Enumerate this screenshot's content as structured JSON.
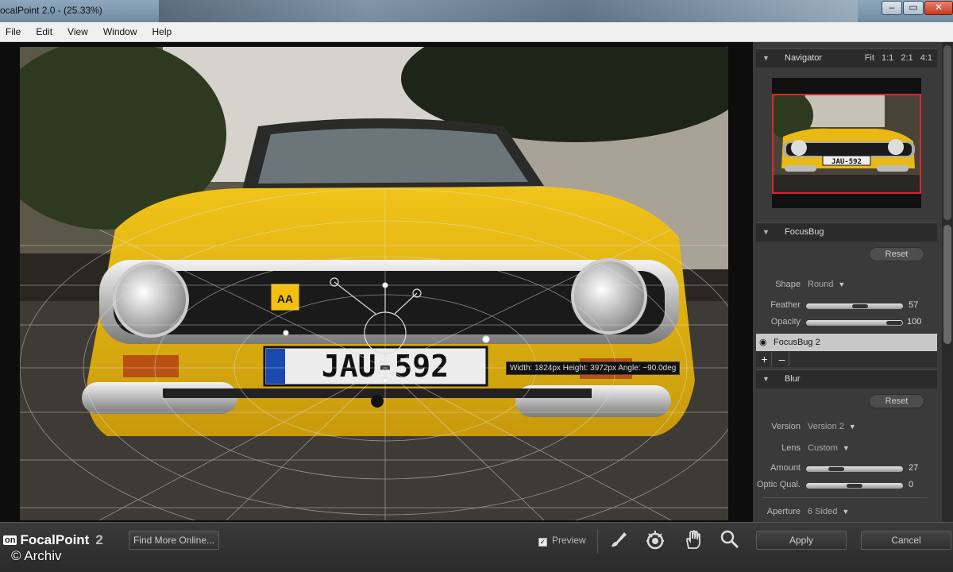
{
  "window": {
    "title": "ocalPoint 2.0 -  (25.33%)",
    "minimize": "–",
    "maximize": "▭",
    "close": "✕"
  },
  "menu": [
    "File",
    "Edit",
    "View",
    "Window",
    "Help"
  ],
  "canvas": {
    "plate_text": "JAU-592",
    "tooltip": "Width: 1824px Height: 3972px Angle: ~90.0deg"
  },
  "navigator": {
    "title": "Navigator",
    "zoom_options": [
      "Fit",
      "1:1",
      "2:1",
      "4:1"
    ],
    "plate_text": "JAU-592"
  },
  "focusbug": {
    "title": "FocusBug",
    "reset": "Reset",
    "shape_label": "Shape",
    "shape_value": "Round",
    "feather_label": "Feather",
    "feather_value": "57",
    "feather_level": 0.57,
    "opacity_label": "Opacity",
    "opacity_value": "100",
    "opacity_level": 1.0,
    "layer_name": "FocusBug 2",
    "add_label": "+",
    "remove_label": "–"
  },
  "blur": {
    "title": "Blur",
    "reset": "Reset",
    "version_label": "Version",
    "version_value": "Version 2",
    "lens_label": "Lens",
    "lens_value": "Custom",
    "amount_label": "Amount",
    "amount_value": "27",
    "amount_level": 0.27,
    "optic_label": "Optic Qual.",
    "optic_value": "0",
    "optic_level": 0.5,
    "aperture_label": "Aperture",
    "aperture_value": "6 Sided"
  },
  "bottombar": {
    "logo_badge": "on",
    "logo_text": "FocalPoint",
    "logo_version": "2",
    "find_more": "Find More Online...",
    "preview_label": "Preview",
    "preview_checked": "✓",
    "apply": "Apply",
    "cancel": "Cancel",
    "copyright": "© Archiv"
  },
  "icons": {
    "brush": "brush-icon",
    "focusbug": "focusbug-icon",
    "hand": "hand-icon",
    "zoom": "zoom-icon"
  }
}
